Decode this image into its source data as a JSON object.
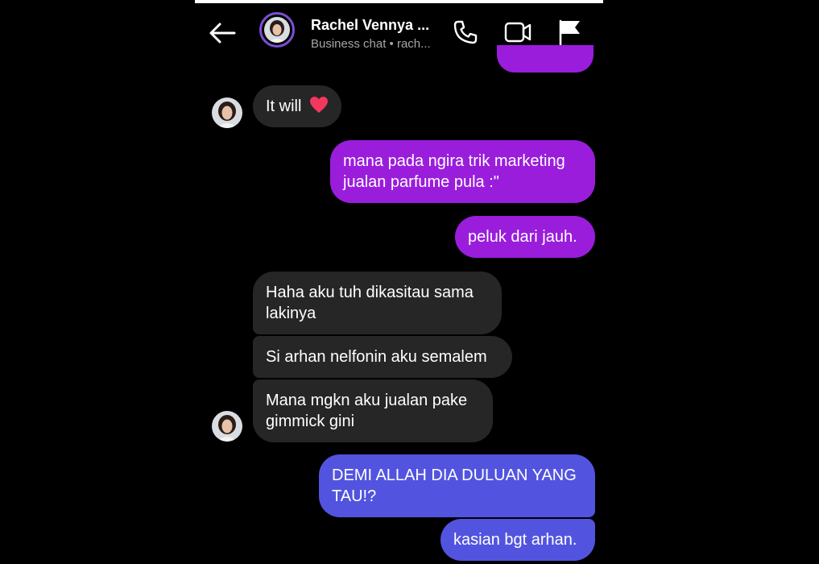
{
  "header": {
    "title": "Rachel Vennya ...",
    "subtitle": "Business chat • rach..."
  },
  "icons": {
    "back": "arrow-left-icon",
    "call": "phone-icon",
    "video": "video-camera-icon",
    "report": "flag-icon",
    "heart": "red-heart-emoji"
  },
  "colors": {
    "received_bubble": "#262626",
    "sent_bubble_violet": "#9a1ddc",
    "sent_bubble_blue": "#5254df",
    "avatar_ring": "#7b4fd6"
  },
  "messages": [
    {
      "from": "them",
      "text": "It will"
    },
    {
      "from": "me",
      "lines": [
        "mana pada ngira trik marketing",
        "jualan parfume pula :\""
      ]
    },
    {
      "from": "me",
      "text": "peluk dari jauh."
    },
    {
      "from": "them",
      "lines": [
        "Haha aku tuh dikasitau sama",
        "lakinya"
      ]
    },
    {
      "from": "them",
      "text": "Si arhan nelfonin aku semalem"
    },
    {
      "from": "them",
      "lines": [
        "Mana mgkn aku jualan pake",
        "gimmick gini"
      ]
    },
    {
      "from": "me",
      "lines": [
        "DEMI ALLAH DIA DULUAN YANG",
        "TAU!?"
      ]
    },
    {
      "from": "me",
      "text": "kasian bgt arhan."
    }
  ]
}
